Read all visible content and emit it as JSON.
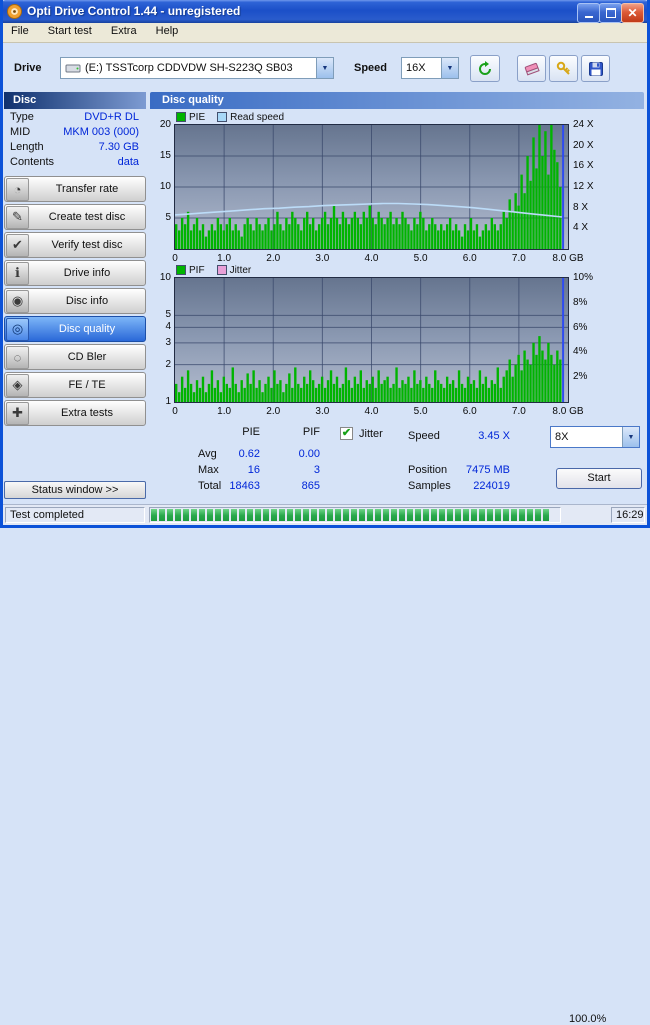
{
  "window": {
    "title": "Opti Drive Control 1.44  -  unregistered"
  },
  "menu": {
    "items": [
      "File",
      "Start test",
      "Extra",
      "Help"
    ]
  },
  "toolbar": {
    "drive_label": "Drive",
    "drive_value": "(E:)  TSSTcorp CDDVDW SH-S223Q SB03",
    "speed_label": "Speed",
    "speed_value": "16X"
  },
  "icons": {
    "dropdown_arrow": "▼",
    "check": "✔",
    "close": "✕"
  },
  "sidebar": {
    "header": "Disc",
    "info": [
      {
        "label": "Type",
        "value": "DVD+R DL"
      },
      {
        "label": "MID",
        "value": "MKM 003 (000)"
      },
      {
        "label": "Length",
        "value": "7.30 GB"
      },
      {
        "label": "Contents",
        "value": "data"
      }
    ],
    "buttons": [
      {
        "label": "Transfer rate",
        "icon": "◔",
        "selected": false
      },
      {
        "label": "Create test disc",
        "icon": "✎",
        "selected": false
      },
      {
        "label": "Verify test disc",
        "icon": "✔",
        "selected": false
      },
      {
        "label": "Drive info",
        "icon": "ℹ",
        "selected": false
      },
      {
        "label": "Disc info",
        "icon": "◉",
        "selected": false
      },
      {
        "label": "Disc quality",
        "icon": "◎",
        "selected": true
      },
      {
        "label": "CD Bler",
        "icon": "◌",
        "selected": false
      },
      {
        "label": "FE / TE",
        "icon": "◈",
        "selected": false
      },
      {
        "label": "Extra tests",
        "icon": "✚",
        "selected": false
      }
    ],
    "status_window": "Status window >>"
  },
  "main": {
    "header": "Disc quality"
  },
  "stats": {
    "col_pie": "PIE",
    "col_pif": "PIF",
    "jitter_label": "Jitter",
    "jitter_checked": true,
    "rows": [
      {
        "label": "Avg",
        "pie": "0.62",
        "pif": "0.00"
      },
      {
        "label": "Max",
        "pie": "16",
        "pif": "3"
      },
      {
        "label": "Total",
        "pie": "18463",
        "pif": "865"
      }
    ],
    "speed_label": "Speed",
    "speed_value": "3.45 X",
    "position_label": "Position",
    "position_value": "7475 MB",
    "samples_label": "Samples",
    "samples_value": "224019",
    "scan_speed": "8X",
    "start_label": "Start"
  },
  "statusbar": {
    "status": "Test completed",
    "progress": "100.0%",
    "progress_pct": 100,
    "time": "16:29"
  },
  "chart_data": [
    {
      "type": "bar",
      "name": "PIE / Read speed",
      "legend": [
        {
          "label": "PIE",
          "color": "#00b400"
        },
        {
          "label": "Read speed",
          "color": "#a8d8f8"
        }
      ],
      "x_max_gb": 8.0,
      "x_ticks": [
        {
          "g": 0,
          "label": "0"
        },
        {
          "g": 1,
          "label": "1.0"
        },
        {
          "g": 2,
          "label": "2.0"
        },
        {
          "g": 3,
          "label": "3.0"
        },
        {
          "g": 4,
          "label": "4.0"
        },
        {
          "g": 5,
          "label": "5.0"
        },
        {
          "g": 6,
          "label": "6.0"
        },
        {
          "g": 7,
          "label": "7.0"
        },
        {
          "g": 8,
          "label": "8.0 GB"
        }
      ],
      "y_left": {
        "scale": "linear",
        "max": 20,
        "ticks": [
          5,
          10,
          15,
          20
        ]
      },
      "y_right": {
        "max": 24,
        "ticks": [
          {
            "v": 4,
            "label": "4 X"
          },
          {
            "v": 8,
            "label": "8 X"
          },
          {
            "v": 12,
            "label": "12 X"
          },
          {
            "v": 16,
            "label": "16 X"
          },
          {
            "v": 20,
            "label": "20 X"
          },
          {
            "v": 24,
            "label": "24 X"
          }
        ]
      },
      "bars": {
        "color": "#00b400",
        "end_gb": 7.88,
        "values": [
          4,
          3,
          5,
          4,
          6,
          3,
          4,
          5,
          3,
          4,
          2,
          3,
          4,
          3,
          5,
          4,
          3,
          4,
          5,
          3,
          4,
          3,
          2,
          4,
          5,
          4,
          3,
          5,
          4,
          3,
          4,
          5,
          3,
          4,
          6,
          4,
          3,
          5,
          4,
          6,
          5,
          4,
          3,
          5,
          6,
          4,
          5,
          3,
          4,
          5,
          6,
          4,
          5,
          7,
          5,
          4,
          6,
          5,
          4,
          5,
          6,
          5,
          4,
          6,
          5,
          7,
          5,
          4,
          6,
          5,
          4,
          5,
          6,
          4,
          5,
          4,
          6,
          5,
          4,
          3,
          5,
          4,
          6,
          5,
          3,
          4,
          5,
          4,
          3,
          4,
          3,
          4,
          5,
          3,
          4,
          3,
          2,
          4,
          3,
          5,
          3,
          4,
          2,
          3,
          4,
          3,
          5,
          4,
          3,
          4,
          6,
          5,
          8,
          6,
          9,
          7,
          12,
          9,
          15,
          11,
          18,
          13,
          20,
          15,
          19,
          12,
          20,
          16,
          14,
          10
        ]
      },
      "line": {
        "name": "Read speed",
        "color": "#bcdcf8",
        "max": 24,
        "end_gb": 7.88,
        "values": [
          6.6,
          6.8,
          7.0,
          7.2,
          7.4,
          7.6,
          7.8,
          7.9,
          8.1,
          8.2,
          8.4,
          8.5,
          8.6,
          8.7,
          8.8,
          8.8,
          8.7,
          8.6,
          8.4,
          8.2,
          8.0,
          7.7,
          7.4,
          7.1,
          6.8,
          6.5,
          6.2
        ]
      },
      "cursor": {
        "gb": 7.9,
        "color": "#2f4cf0"
      }
    },
    {
      "type": "bar",
      "name": "PIF / Jitter",
      "legend": [
        {
          "label": "PIF",
          "color": "#00b400"
        },
        {
          "label": "Jitter",
          "color": "#e8a0d8"
        }
      ],
      "x_max_gb": 8.0,
      "x_ticks": [
        {
          "g": 0,
          "label": "0"
        },
        {
          "g": 1,
          "label": "1.0"
        },
        {
          "g": 2,
          "label": "2.0"
        },
        {
          "g": 3,
          "label": "3.0"
        },
        {
          "g": 4,
          "label": "4.0"
        },
        {
          "g": 5,
          "label": "5.0"
        },
        {
          "g": 6,
          "label": "6.0"
        },
        {
          "g": 7,
          "label": "7.0"
        },
        {
          "g": 8,
          "label": "8.0 GB"
        }
      ],
      "y_left": {
        "scale": "log",
        "max": 10,
        "ticks": [
          1,
          2,
          3,
          4,
          5,
          10
        ]
      },
      "y_right": {
        "max": 10,
        "ticks": [
          {
            "v": 2,
            "label": "2%"
          },
          {
            "v": 4,
            "label": "4%"
          },
          {
            "v": 6,
            "label": "6%"
          },
          {
            "v": 8,
            "label": "8%"
          },
          {
            "v": 10,
            "label": "10%"
          }
        ]
      },
      "bars": {
        "color": "#00b400",
        "end_gb": 7.88,
        "values": [
          1.4,
          1.2,
          1.6,
          1.3,
          1.8,
          1.4,
          1.2,
          1.5,
          1.3,
          1.6,
          1.2,
          1.4,
          1.8,
          1.3,
          1.5,
          1.2,
          1.6,
          1.4,
          1.3,
          1.9,
          1.4,
          1.2,
          1.5,
          1.3,
          1.7,
          1.4,
          1.8,
          1.3,
          1.5,
          1.2,
          1.4,
          1.6,
          1.3,
          1.8,
          1.4,
          1.5,
          1.2,
          1.4,
          1.7,
          1.3,
          1.9,
          1.4,
          1.3,
          1.6,
          1.4,
          1.8,
          1.5,
          1.3,
          1.4,
          1.6,
          1.3,
          1.5,
          1.8,
          1.4,
          1.6,
          1.3,
          1.4,
          1.9,
          1.5,
          1.3,
          1.6,
          1.4,
          1.8,
          1.3,
          1.5,
          1.4,
          1.6,
          1.3,
          1.8,
          1.4,
          1.5,
          1.6,
          1.3,
          1.4,
          1.9,
          1.3,
          1.5,
          1.4,
          1.6,
          1.3,
          1.8,
          1.4,
          1.5,
          1.3,
          1.6,
          1.4,
          1.3,
          1.8,
          1.5,
          1.4,
          1.3,
          1.6,
          1.4,
          1.5,
          1.3,
          1.8,
          1.4,
          1.3,
          1.6,
          1.4,
          1.5,
          1.3,
          1.8,
          1.4,
          1.6,
          1.3,
          1.5,
          1.4,
          1.9,
          1.3,
          1.6,
          1.8,
          2.2,
          1.6,
          2.0,
          2.4,
          1.8,
          2.6,
          2.2,
          2.0,
          3.0,
          2.4,
          3.4,
          2.6,
          2.2,
          3.0,
          2.4,
          2.0,
          2.6,
          2.2
        ]
      },
      "cursor": {
        "gb": 7.9,
        "color": "#2f4cf0"
      }
    }
  ]
}
